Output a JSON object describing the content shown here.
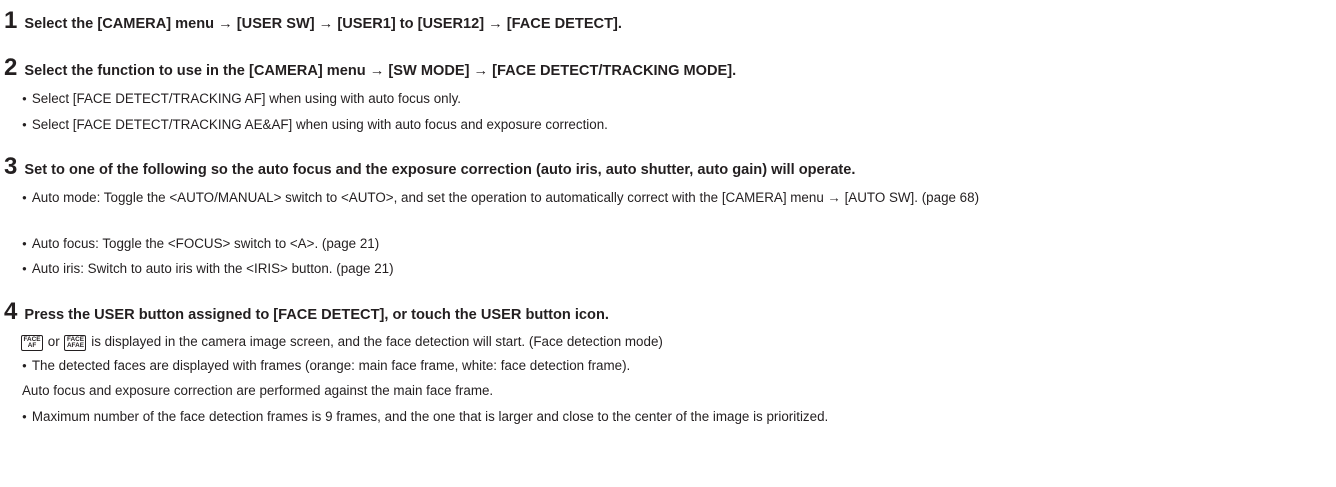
{
  "steps": [
    {
      "number": "1",
      "heading": "Select the [CAMERA] menu → [USER SW] → [USER1] to [USER12] → [FACE DETECT].",
      "bullets": []
    },
    {
      "number": "2",
      "heading": "Select the function to use in the [CAMERA] menu → [SW MODE] → [FACE DETECT/TRACKING MODE].",
      "bullets": [
        "Select [FACE DETECT/TRACKING AF] when using with auto focus only.",
        "Select [FACE DETECT/TRACKING AE&AF] when using with auto focus and exposure correction."
      ]
    },
    {
      "number": "3",
      "heading": "Set to one of the following so the auto focus and the exposure correction (auto iris, auto shutter, auto gain) will operate.",
      "bullets": [
        "Auto mode: Toggle the <AUTO/MANUAL> switch to <AUTO>, and set the operation to automatically correct with the [CAMERA] menu → [AUTO SW]. (page 68)",
        "Auto focus: Toggle the <FOCUS> switch to <A>. (page 21)",
        "Auto iris: Switch to auto iris with the <IRIS> button. (page 21)"
      ]
    },
    {
      "number": "4",
      "heading": "Press the USER button assigned to [FACE DETECT], or touch the USER button icon.",
      "result_line": {
        "icon1_top": "FACE",
        "icon1_bottom": "AF",
        "connector": "or",
        "icon2_top": "FACE",
        "icon2_bottom": "AFAE",
        "text": "is displayed in the camera image screen, and the face detection will start. (Face detection mode)"
      },
      "bullets": [
        "The detected faces are displayed with frames (orange: main face frame, white: face detection frame).",
        "Auto focus and exposure correction are performed against the main face frame.",
        "Maximum number of the face detection frames is 9 frames, and the one that is larger and close to the center of the image is prioritized."
      ]
    }
  ],
  "bullet_symbol": "●"
}
